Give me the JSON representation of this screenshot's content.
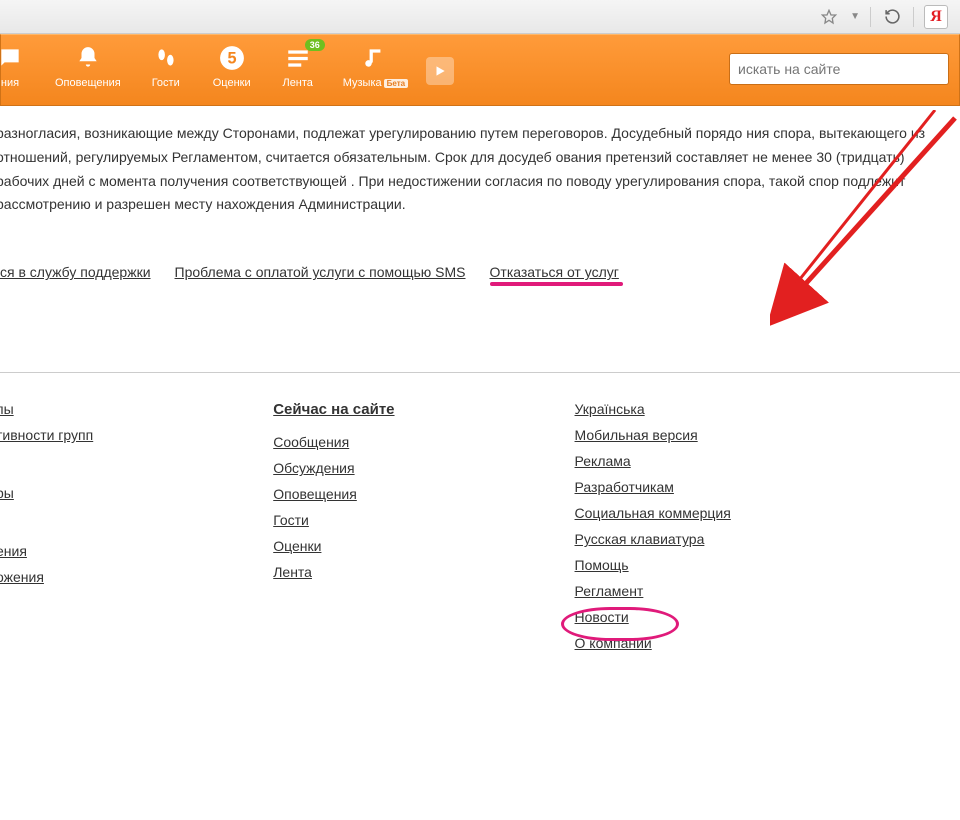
{
  "browser": {
    "star_icon": "star-icon",
    "reload_icon": "reload-icon",
    "yandex_letter": "Я"
  },
  "nav": {
    "items": [
      {
        "label": "ния",
        "icon": "messages-icon"
      },
      {
        "label": "Оповещения",
        "icon": "bell-icon"
      },
      {
        "label": "Гости",
        "icon": "footprints-icon"
      },
      {
        "label": "Оценки",
        "icon": "five-icon"
      },
      {
        "label": "Лента",
        "icon": "feed-icon",
        "badge": "36"
      },
      {
        "label": "Музыка",
        "icon": "music-icon",
        "beta": "Бета"
      }
    ],
    "search_placeholder": "искать на сайте"
  },
  "paragraph": "разногласия, возникающие между Сторонами, подлежат урегулированию путем переговоров. Досудебный порядо ния спора, вытекающего из отношений, регулируемых Регламентом, считается обязательным. Срок для досудеб ования претензий составляет не менее 30 (тридцать) рабочих дней с момента получения соответствующей . При недостижении согласия по поводу урегулирования спора, такой спор подлежит рассмотрению и разрешен месту нахождения Администрации.",
  "support_links": {
    "contact": "ся в службу поддержки",
    "sms": "Проблема с оплатой услуги с помощью SMS",
    "refuse": "Отказаться от услуг"
  },
  "footer": {
    "left_fragments": {
      "a": "пы",
      "b": "тивности групп",
      "c": "ры",
      "d": "ения",
      "e": "ожения"
    },
    "col_center": {
      "heading": "Сейчас на сайте",
      "links": [
        "Сообщения",
        "Обсуждения",
        "Оповещения",
        "Гости",
        "Оценки",
        "Лента"
      ]
    },
    "col_right": {
      "links": [
        "Українська",
        "Мобильная версия",
        "Реклама",
        "Разработчикам",
        "Социальная коммерция",
        "Русская клавиатура",
        "Помощь",
        "Регламент",
        "Новости",
        "О компании"
      ]
    }
  },
  "annotation": {
    "arrow_color": "#e22020",
    "circle_color": "#e01a7a"
  }
}
